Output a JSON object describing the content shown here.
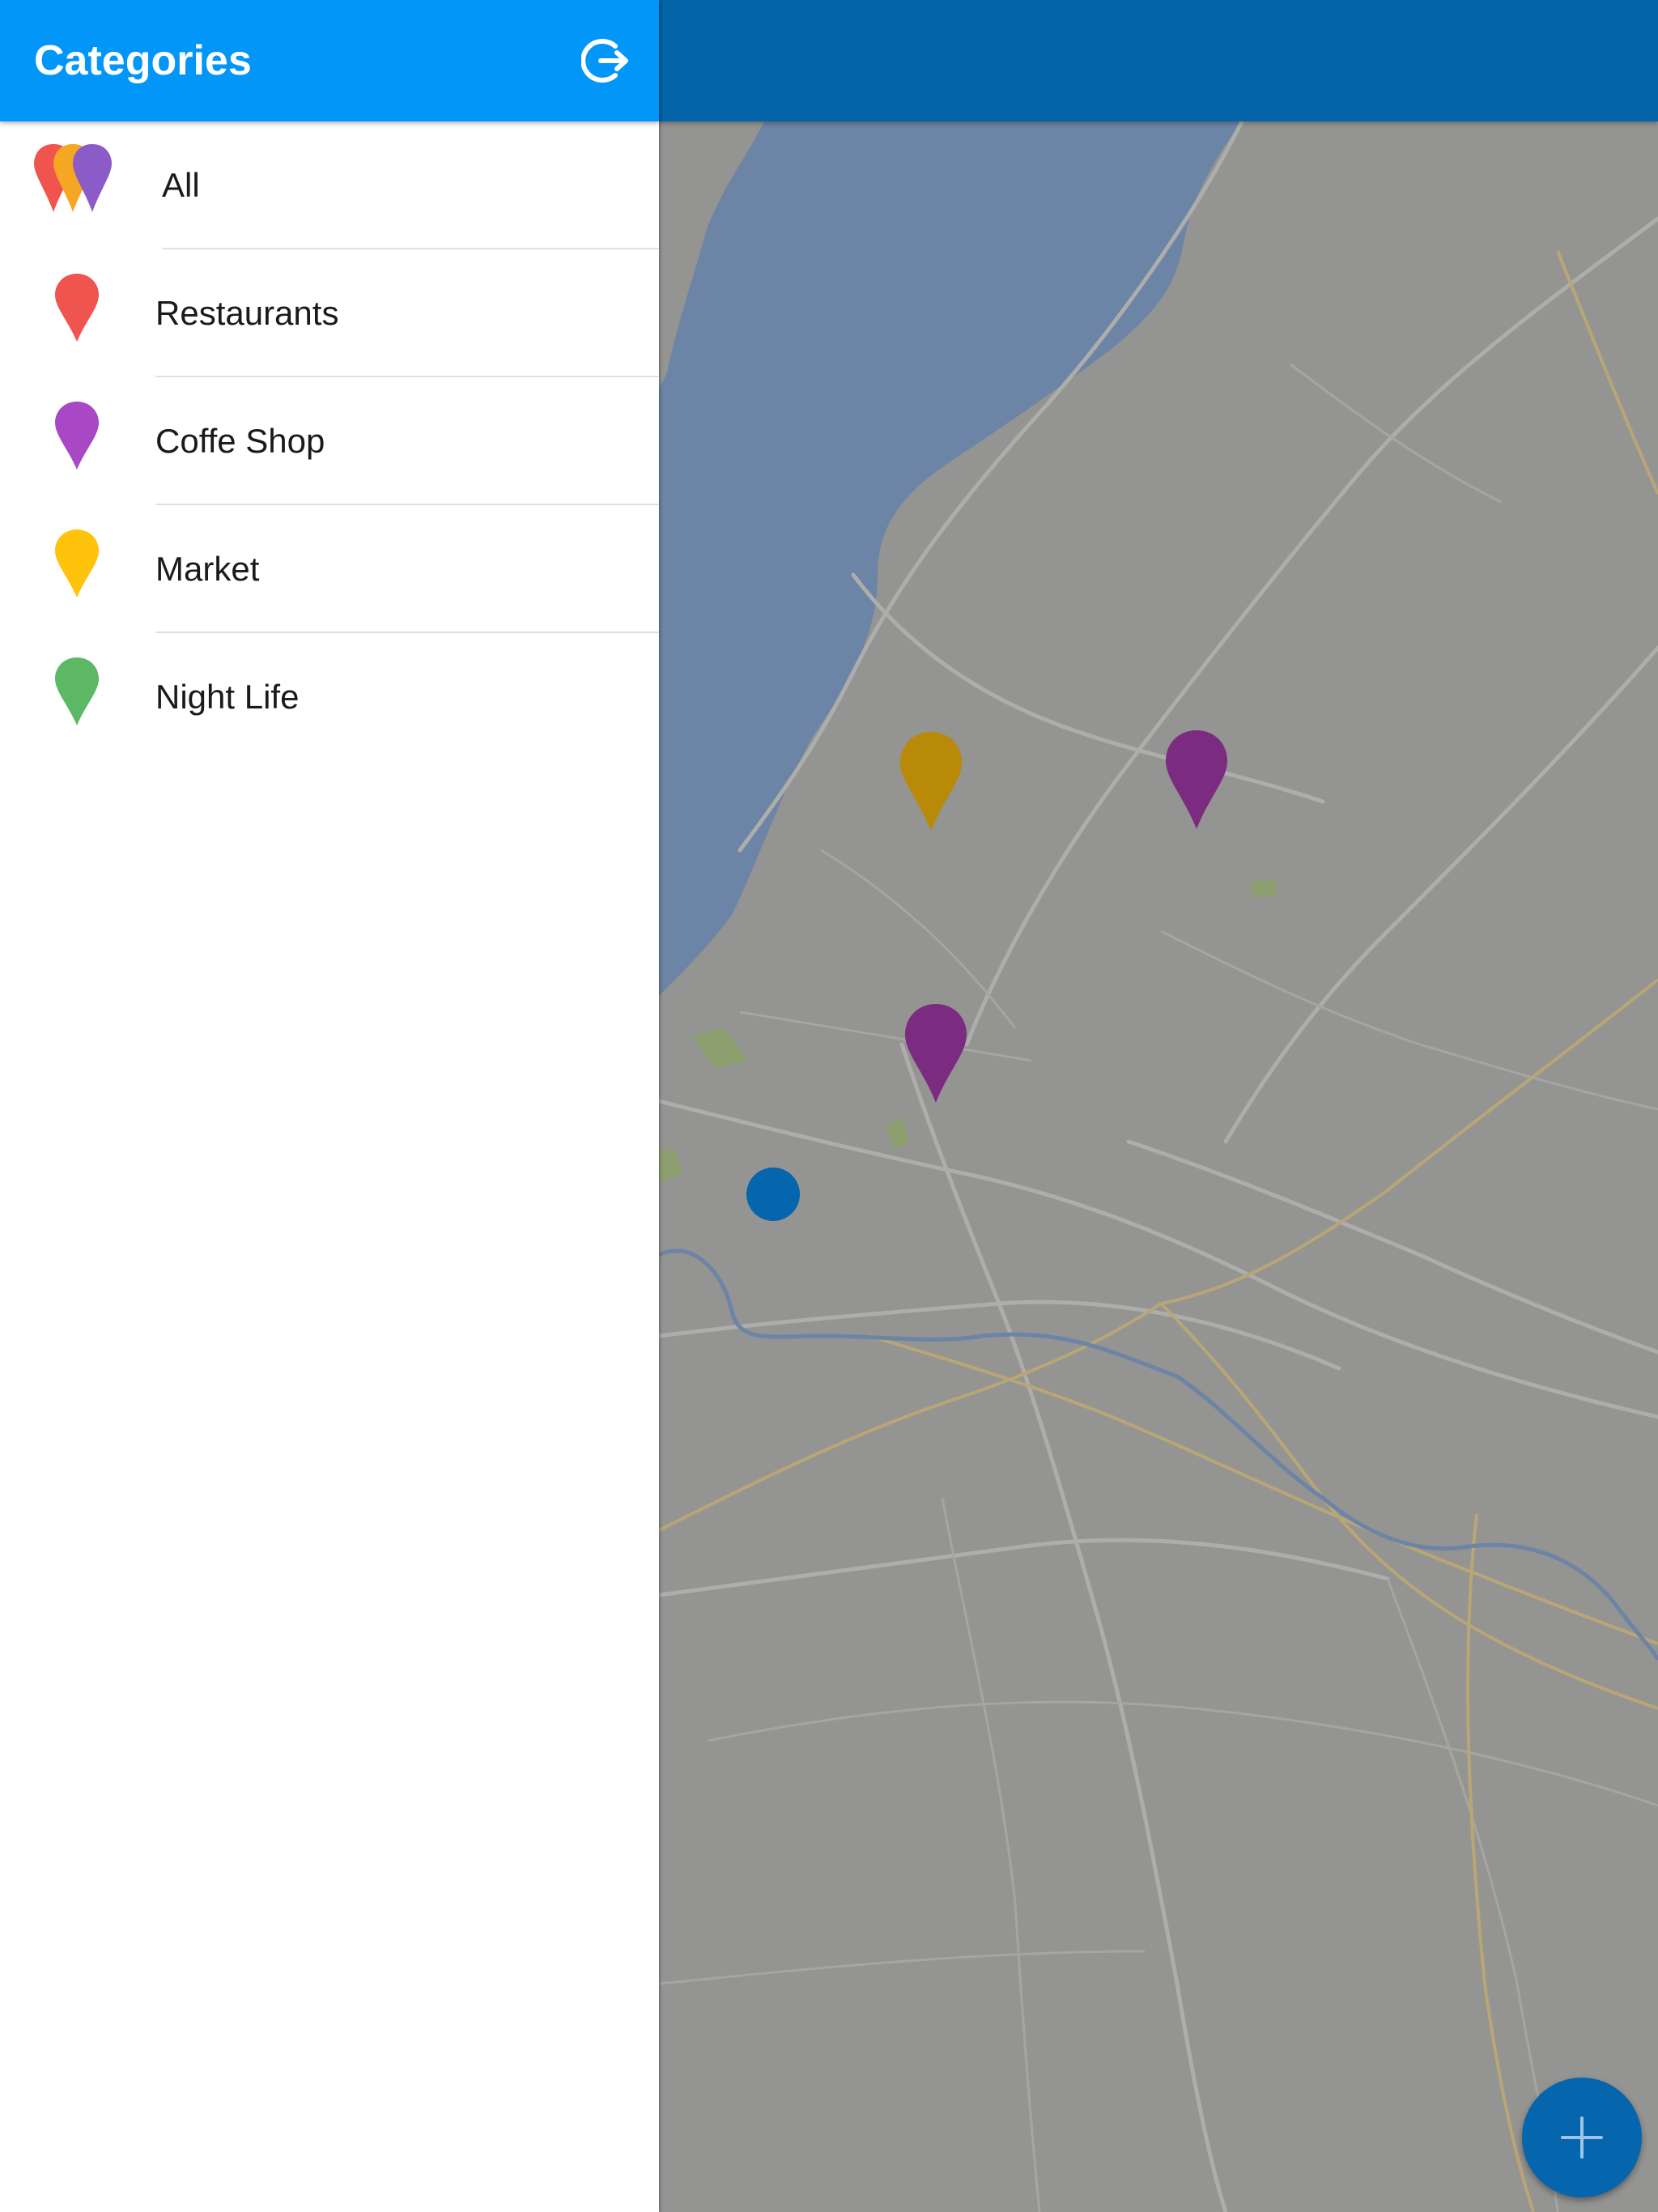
{
  "drawer": {
    "title": "Categories",
    "logout_icon": "logout-icon",
    "categories": [
      {
        "label": "All",
        "icon": "multi-pin-icon",
        "colors": [
          "#f0544f",
          "#f5a623",
          "#8b5cc8"
        ]
      },
      {
        "label": "Restaurants",
        "icon": "pin-icon",
        "color": "#f0544f"
      },
      {
        "label": "Coffe Shop",
        "icon": "pin-icon",
        "color": "#a948c4"
      },
      {
        "label": "Market",
        "icon": "pin-icon",
        "color": "#fec30a"
      },
      {
        "label": "Night Life",
        "icon": "pin-icon",
        "color": "#5cb864"
      }
    ]
  },
  "map": {
    "water_color": "#6c84a5",
    "land_color": "#949492",
    "markers": [
      {
        "category": "Market",
        "color": "#b88a08"
      },
      {
        "category": "Coffe Shop",
        "color": "#7b2c80"
      },
      {
        "category": "Coffe Shop",
        "color": "#7b2c80"
      }
    ],
    "user_location_color": "#0565ad"
  },
  "fab": {
    "icon": "plus-icon",
    "color": "#0565ad"
  },
  "colors": {
    "header": "#0296f8",
    "map_topbar": "#0364a8"
  }
}
